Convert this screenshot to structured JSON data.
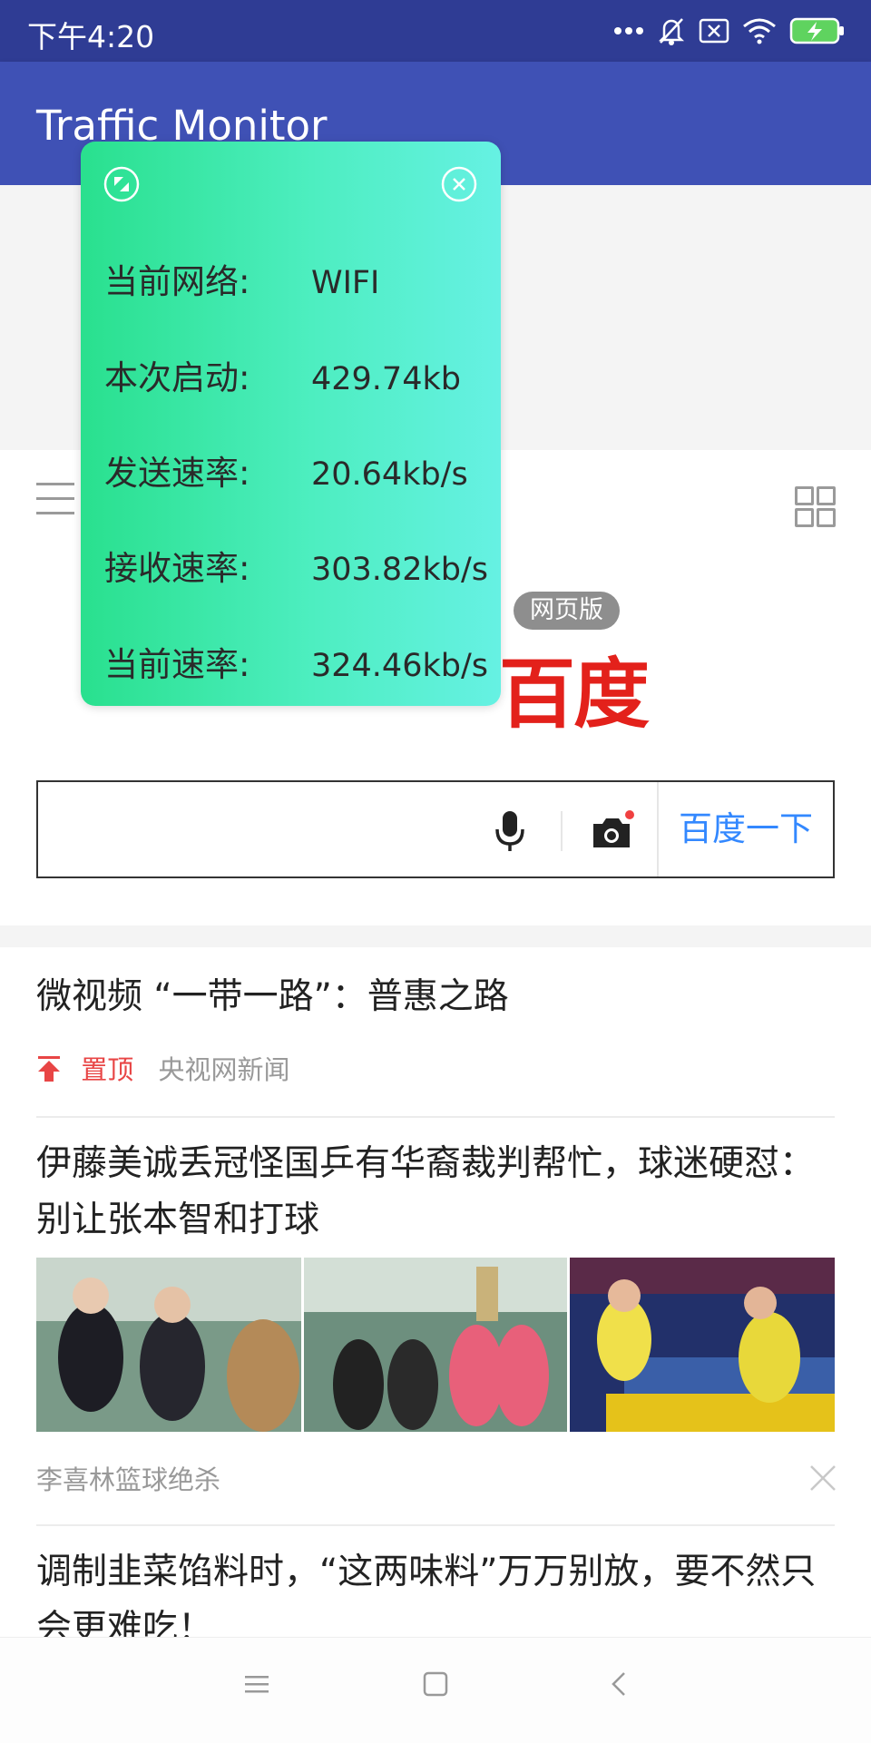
{
  "status_bar": {
    "time": "下午4:20",
    "icons": [
      "more-dots-icon",
      "bell-off-icon",
      "sim-x-icon",
      "wifi-icon",
      "battery-charging-icon"
    ],
    "color": "#2f3c94"
  },
  "app_bar": {
    "title": "Traffic Monitor",
    "color": "#3f51b5"
  },
  "overlay": {
    "rows": [
      {
        "label": "当前网络:",
        "value": "WIFI"
      },
      {
        "label": "本次启动:",
        "value": "429.74kb"
      },
      {
        "label": "发送速率:",
        "value": "20.64kb/s"
      },
      {
        "label": "接收速率:",
        "value": "303.82kb/s"
      },
      {
        "label": "当前速率:",
        "value": "324.46kb/s"
      }
    ],
    "icons": [
      "resize-icon",
      "close-icon"
    ]
  },
  "baidu": {
    "logo_text": "百度",
    "badge": "网页版",
    "search_button": "百度一下",
    "search_value": "",
    "brand_blue": "#3388ff",
    "brand_red": "#e3211b"
  },
  "feed": {
    "items": [
      {
        "title": "微视频 “一带一路”：普惠之路",
        "pin": "置顶",
        "source": "央视网新闻"
      },
      {
        "title": "伊藤美诚丢冠怪国乒有华裔裁判帮忙，球迷硬怼：别让张本智和打球",
        "source": "李喜林篮球绝杀"
      },
      {
        "title": "调制韭菜馅料时，“这两味料”万万别放，要不然只会更难吃！"
      }
    ]
  },
  "nav_bar": {
    "icons": [
      "menu-icon",
      "home-square-icon",
      "back-chevron-icon"
    ]
  }
}
